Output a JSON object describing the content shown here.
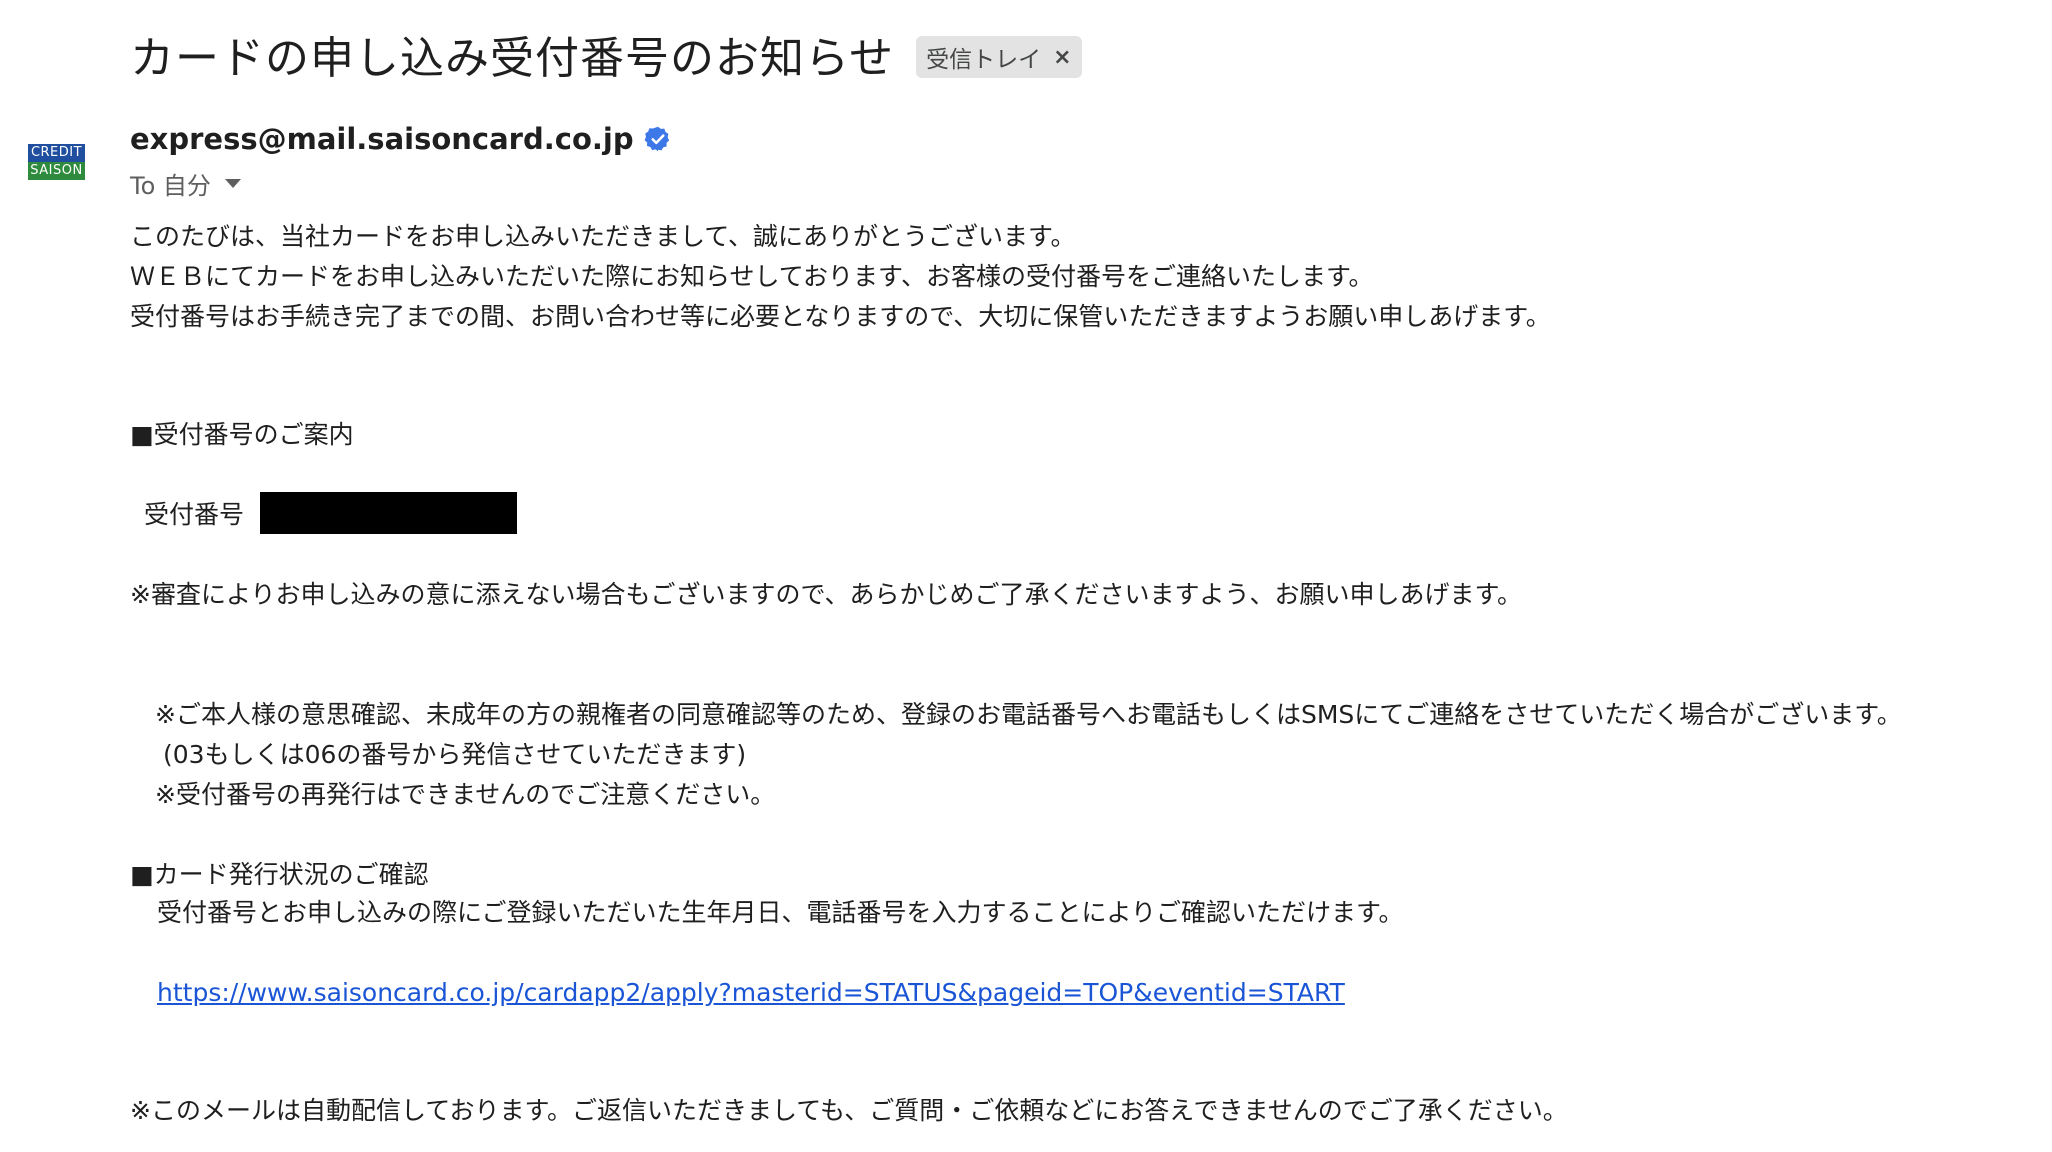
{
  "email": {
    "subject": "カードの申し込み受付番号のお知らせ",
    "label": "受信トレイ",
    "label_close": "×",
    "avatar": {
      "top": "CREDIT",
      "bottom": "SAISON"
    },
    "sender": "express@mail.saisoncard.co.jp",
    "verified_icon": "verified-badge-icon",
    "to": "To 自分",
    "body": {
      "intro1": "このたびは、当社カードをお申し込みいただきまして、誠にありがとうございます。",
      "intro2": "ＷＥＢにてカードをお申し込みいただいた際にお知らせしております、お客様の受付番号をご連絡いたします。",
      "intro3": "受付番号はお手続き完了までの間、お問い合わせ等に必要となりますので、大切に保管いただきますようお願い申しあげます。",
      "section1_title": "■受付番号のご案内",
      "receipt_label": "受付番号",
      "note1": "※審査によりお申し込みの意に添えない場合もございますので、あらかじめご了承くださいますよう、お願い申しあげます。",
      "note2": "※ご本人様の意思確認、未成年の方の親権者の同意確認等のため、登録のお電話番号へお電話もしくはSMSにてご連絡をさせていただく場合がございます。",
      "note2b": "(03もしくは06の番号から発信させていただきます)",
      "note3": "※受付番号の再発行はできませんのでご注意ください。",
      "section2_title": "■カード発行状況のご確認",
      "section2_text": "受付番号とお申し込みの際にご登録いただいた生年月日、電話番号を入力することによりご確認いただけます。",
      "link": "https://www.saisoncard.co.jp/cardapp2/apply?masterid=STATUS&pageid=TOP&eventid=START",
      "footer": "※このメールは自動配信しております。ご返信いただきましても、ご質問・ご依頼などにお答えできませんのでご了承ください。"
    }
  },
  "colors": {
    "link": "#1a55d6",
    "verified": "#3c78e8",
    "chip_bg": "#e3e3e3"
  }
}
